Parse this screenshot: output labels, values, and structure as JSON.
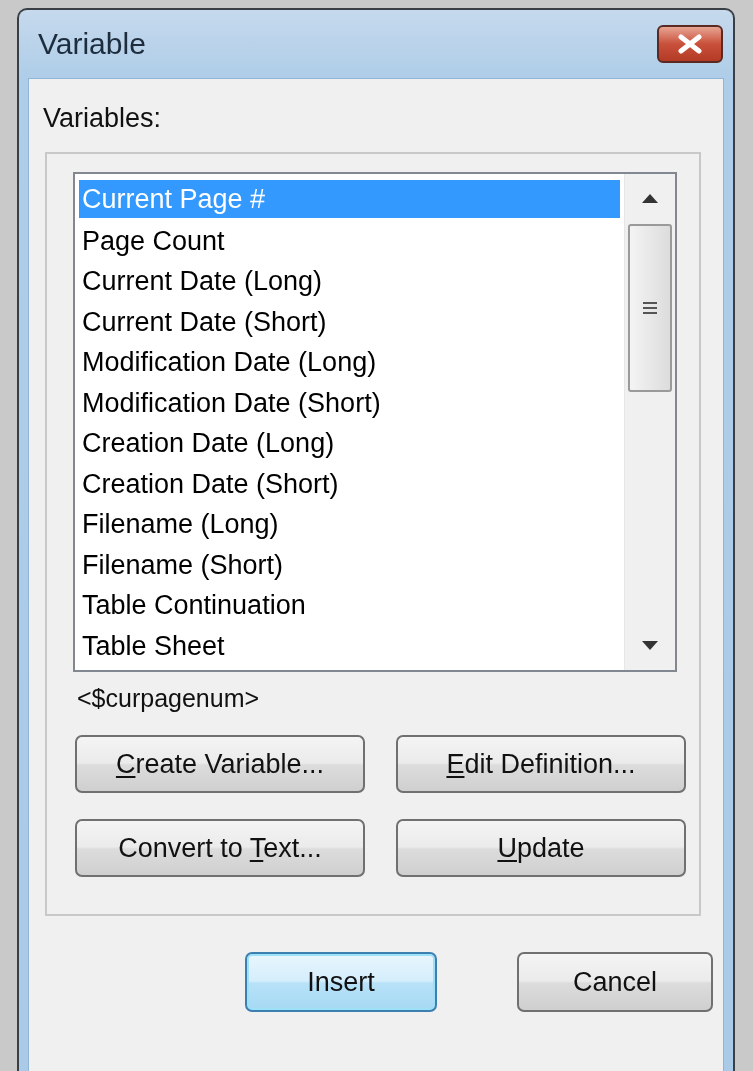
{
  "window": {
    "title": "Variable"
  },
  "variables_label": "Variables:",
  "variables": [
    {
      "label": "Current Page #",
      "selected": true
    },
    {
      "label": "Page Count",
      "selected": false
    },
    {
      "label": "Current Date (Long)",
      "selected": false
    },
    {
      "label": "Current Date (Short)",
      "selected": false
    },
    {
      "label": "Modification Date (Long)",
      "selected": false
    },
    {
      "label": "Modification Date (Short)",
      "selected": false
    },
    {
      "label": "Creation Date (Long)",
      "selected": false
    },
    {
      "label": "Creation Date (Short)",
      "selected": false
    },
    {
      "label": "Filename (Long)",
      "selected": false
    },
    {
      "label": "Filename (Short)",
      "selected": false
    },
    {
      "label": "Table Continuation",
      "selected": false
    },
    {
      "label": "Table Sheet",
      "selected": false
    }
  ],
  "definition": "<$curpagenum>",
  "group_buttons": [
    {
      "label_parts": [
        {
          "text": "C",
          "underlined": true
        },
        {
          "text": "reate Variable...",
          "underlined": false
        }
      ]
    },
    {
      "label_parts": [
        {
          "text": "E",
          "underlined": true
        },
        {
          "text": "dit Definition...",
          "underlined": false
        }
      ]
    },
    {
      "label_parts": [
        {
          "text": "Convert to ",
          "underlined": false
        },
        {
          "text": "T",
          "underlined": true
        },
        {
          "text": "ext...",
          "underlined": false
        }
      ]
    },
    {
      "label_parts": [
        {
          "text": "U",
          "underlined": true
        },
        {
          "text": "pdate",
          "underlined": false
        }
      ]
    }
  ],
  "dialog_buttons": [
    {
      "label": "Insert",
      "default": true
    },
    {
      "label": "Cancel",
      "default": false
    }
  ]
}
